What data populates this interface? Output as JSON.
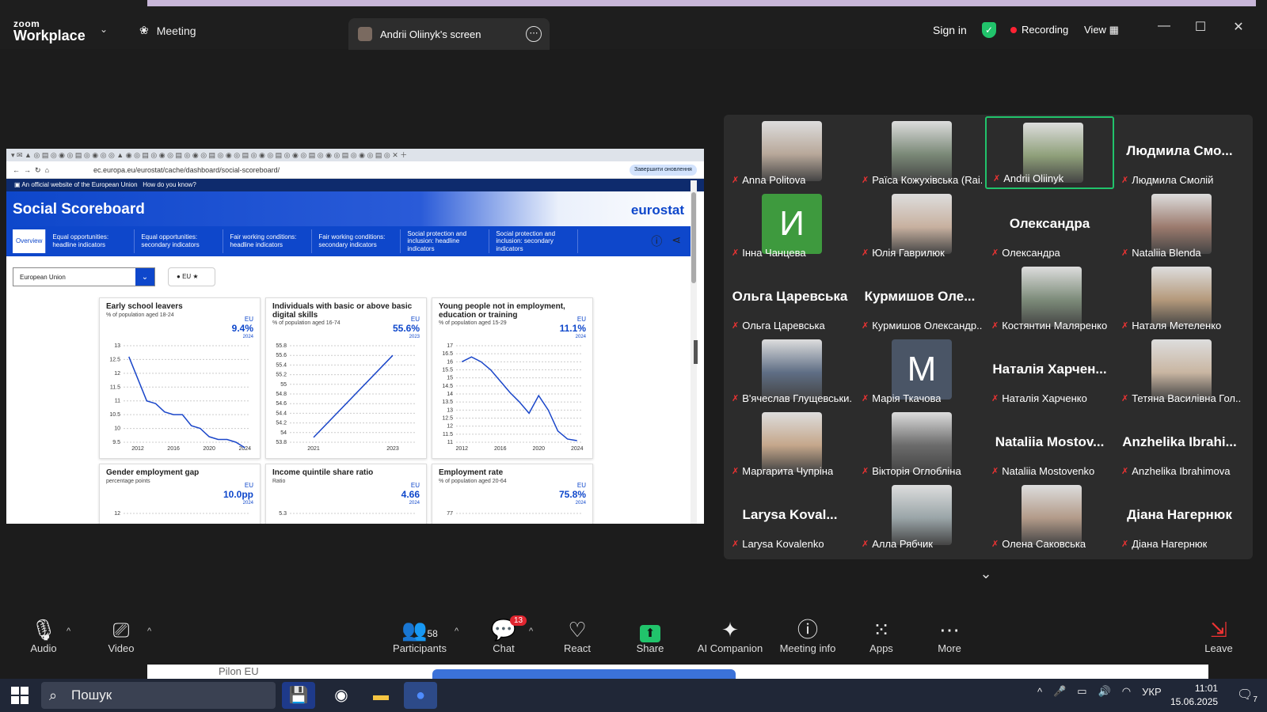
{
  "app": {
    "logo_top": "zoom",
    "logo_bottom": "Workplace",
    "meeting_label": "Meeting",
    "screen_tab_label": "Andrii Oliinyk's screen",
    "sign_in": "Sign in",
    "recording": "Recording",
    "view": "View"
  },
  "browser": {
    "url": "ec.europa.eu/eurostat/cache/dashboard/social-scoreboard/",
    "update_button": "Завершити оновлення",
    "official_notice": "An official website of the European Union",
    "how_know": "How do you know?"
  },
  "site": {
    "title": "Social Scoreboard",
    "brand": "eurostat",
    "nav": [
      {
        "label": "Overview"
      },
      {
        "label": "Equal opportunities: headline indicators"
      },
      {
        "label": "Equal opportunities: secondary indicators"
      },
      {
        "label": "Fair working conditions: headline indicators"
      },
      {
        "label": "Fair working conditions: secondary indicators"
      },
      {
        "label": "Social protection and inclusion: headline indicators"
      },
      {
        "label": "Social protection and inclusion: secondary indicators"
      }
    ],
    "region_select": "European Union",
    "eu_badge": "EU"
  },
  "cards": [
    {
      "title": "Early school leavers",
      "subtitle": "% of population aged 18-24",
      "eu": "EU",
      "value": "9.4%",
      "year": "2024"
    },
    {
      "title": "Individuals with basic or above basic digital skills",
      "subtitle": "% of population aged 16-74",
      "eu": "EU",
      "value": "55.6%",
      "year": "2023"
    },
    {
      "title": "Young people not in employment, education or training",
      "subtitle": "% of population aged 15-29",
      "eu": "EU",
      "value": "11.1%",
      "year": "2024"
    },
    {
      "title": "Gender employment gap",
      "subtitle": "percentage points",
      "eu": "EU",
      "value": "10.0pp",
      "year": "2024"
    },
    {
      "title": "Income quintile share ratio",
      "subtitle": "Ratio",
      "eu": "EU",
      "value": "4.66",
      "year": "2024"
    },
    {
      "title": "Employment rate",
      "subtitle": "% of population aged 20-64",
      "eu": "EU",
      "value": "75.8%",
      "year": "2024"
    }
  ],
  "chart_data": [
    {
      "type": "line",
      "x": [
        2011,
        2012,
        2013,
        2014,
        2015,
        2016,
        2017,
        2018,
        2019,
        2020,
        2021,
        2022,
        2023,
        2024
      ],
      "series": [
        {
          "values": [
            12.6,
            11.8,
            11.0,
            10.9,
            10.6,
            10.5,
            10.5,
            10.1,
            10.0,
            9.7,
            9.6,
            9.6,
            9.5,
            9.3
          ]
        }
      ],
      "ylim": [
        9.5,
        13
      ],
      "yticks": [
        9.5,
        10,
        10.5,
        11,
        11.5,
        12,
        12.5,
        13
      ],
      "xticks": [
        2012,
        2016,
        2020,
        2024
      ]
    },
    {
      "type": "line",
      "x": [
        2021,
        2023
      ],
      "series": [
        {
          "values": [
            53.9,
            55.6
          ]
        }
      ],
      "ylim": [
        53.8,
        55.8
      ],
      "yticks": [
        53.8,
        54,
        54.2,
        54.4,
        54.6,
        54.8,
        55,
        55.2,
        55.4,
        55.6,
        55.8
      ],
      "xticks": [
        2021,
        2023
      ]
    },
    {
      "type": "line",
      "x": [
        2012,
        2013,
        2014,
        2015,
        2016,
        2017,
        2018,
        2019,
        2020,
        2021,
        2022,
        2023,
        2024
      ],
      "series": [
        {
          "values": [
            16.0,
            16.3,
            16.0,
            15.5,
            14.8,
            14.1,
            13.5,
            12.8,
            13.9,
            13.0,
            11.7,
            11.2,
            11.1
          ]
        }
      ],
      "ylim": [
        11,
        17
      ],
      "yticks": [
        11,
        11.5,
        12,
        12.5,
        13,
        13.5,
        14,
        14.5,
        15,
        15.5,
        16,
        16.5,
        17
      ],
      "xticks": [
        2012,
        2016,
        2020,
        2024
      ]
    },
    {
      "type": "line",
      "yticks_partial": [
        12
      ]
    },
    {
      "type": "line",
      "yticks_partial": [
        5.3
      ]
    },
    {
      "type": "line",
      "yticks_partial": [
        77
      ]
    }
  ],
  "participants": [
    {
      "big": "",
      "name": "Anna Politova",
      "photo": true,
      "color": "#b8a89a"
    },
    {
      "big": "",
      "name": "Раїса Кожухівська (Rai...",
      "photo": true,
      "color": "#7b8a78"
    },
    {
      "big": "",
      "name": "Andrii Oliinyk",
      "photo": true,
      "color": "#8fa07a",
      "active": true
    },
    {
      "big": "Людмила Смо...",
      "name": "Людмила Смолій"
    },
    {
      "big": "",
      "name": "Інна Чанцева",
      "letter": "И",
      "color": "#3e9a3e"
    },
    {
      "big": "",
      "name": "Юлія Гаврилюк",
      "photo": true,
      "color": "#c8b1a0"
    },
    {
      "big": "Олександра",
      "name": "Олександра"
    },
    {
      "big": "",
      "name": "Nataliia Blenda",
      "photo": true,
      "color": "#9c7b6e"
    },
    {
      "big": "Ольга Царевська",
      "name": "Ольга Царевська"
    },
    {
      "big": "Курмишов Оле...",
      "name": "Курмишов Олександр..."
    },
    {
      "big": "",
      "name": "Костянтин Маляренко",
      "photo": true,
      "color": "#7d8c7a"
    },
    {
      "big": "",
      "name": "Наталя Метеленко",
      "photo": true,
      "color": "#b59a7c"
    },
    {
      "big": "",
      "name": "В'ячеслав Глущевськи...",
      "photo": true,
      "color": "#5f6e85"
    },
    {
      "big": "",
      "name": "Марія Ткачова",
      "letter": "M",
      "color": "#4a5566"
    },
    {
      "big": "Наталія Харчен...",
      "name": "Наталія Харченко"
    },
    {
      "big": "",
      "name": "Тетяна Василівна Гол...",
      "photo": true,
      "color": "#c9b6a2"
    },
    {
      "big": "",
      "name": "Маргарита Чупріна",
      "photo": true,
      "color": "#c5a78b"
    },
    {
      "big": "",
      "name": "Вікторія Оглобліна",
      "photo": true,
      "color": "#6b6b6b"
    },
    {
      "big": "Nataliia Mostov...",
      "name": "Nataliia Mostovenko"
    },
    {
      "big": "Anzhelika Ibrahi...",
      "name": "Anzhelika Ibrahimova"
    },
    {
      "big": "Larysa Koval...",
      "name": "Larysa Kovalenko"
    },
    {
      "big": "",
      "name": "Алла Рябчик",
      "photo": true,
      "color": "#9aa5a8"
    },
    {
      "big": "",
      "name": "Олена Саковська",
      "photo": true,
      "color": "#b39b8a"
    },
    {
      "big": "Діана Нагернюк",
      "name": "Діана Нагернюк"
    }
  ],
  "toolbar": {
    "audio": "Audio",
    "video": "Video",
    "participants": "Participants",
    "participants_count": "58",
    "chat": "Chat",
    "chat_badge": "13",
    "react": "React",
    "share": "Share",
    "ai_companion": "AI Companion",
    "meeting_info": "Meeting info",
    "apps": "Apps",
    "more": "More",
    "leave": "Leave"
  },
  "peek": {
    "text": "Pilon EU"
  },
  "taskbar": {
    "search_placeholder": "Пошук",
    "lang": "УКР",
    "time": "11:01",
    "date": "15.06.2025",
    "notif_count": "7"
  }
}
